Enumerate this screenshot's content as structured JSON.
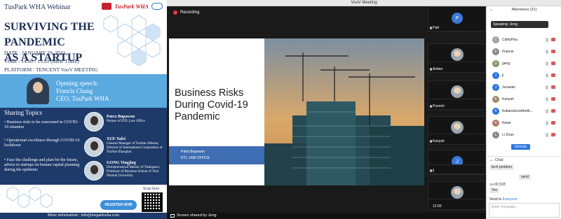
{
  "window": {
    "title": "VooV Meeting"
  },
  "poster": {
    "top_title": "TusPark WHA Webinar",
    "logo_text": "TusPark WHA",
    "headline_1": "SURVIVING THE PANDEMIC",
    "headline_2": "AS A STARTUP",
    "date": "DATE : JANUARY 29, 2021",
    "time": "TIME : 14.00 - 15.20 (BKK TIME)",
    "platform": "PLATFORM : TENCENT VooV MEETING",
    "opening_label": "Opening speech:",
    "opening_name": "Francis Chang",
    "opening_role": "CEO, TusPark WHA",
    "topics_title": "Sharing Topics",
    "topics": [
      "• Business risks to be concerned in COVID-19 situation",
      "• Operational excellence through COVID-19 lockdown",
      "• Face the challenge and plan for the future, advice to startups on human capital planning during the epidemic"
    ],
    "speakers": [
      {
        "name": "Patra Bupawon",
        "role": "Partner of DTL Law Office"
      },
      {
        "name": "XUE Yafei",
        "role": "General Manager of TusStar Alberta; Director of International Corporation of TusStar Shanghai"
      },
      {
        "name": "GONG Yingjing",
        "role": "Entrepreneurial Mentor of Tuskspace; Professor of Business School of Yuxi Normal University"
      }
    ],
    "scan_here": "Scan here",
    "register_label": "REGISTER NOW",
    "more_info": "More information : info@tusparkwha.com"
  },
  "meeting": {
    "recording_label": "Recording",
    "slide": {
      "title": "Business Risks During Covid-19 Pandemic",
      "presenter_name": "Patra Bupawon",
      "presenter_org": "DTL LAW OFFICE"
    },
    "share_label": "Screen shared by Jeng",
    "tiles": [
      {
        "name": "Patt",
        "kind": "avatar",
        "initial": "P"
      },
      {
        "name": "",
        "kind": "photo",
        "initial": ""
      },
      {
        "name": "Amber",
        "kind": "none",
        "initial": ""
      },
      {
        "name": "",
        "kind": "photo",
        "initial": ""
      },
      {
        "name": "Poorich",
        "kind": "none",
        "initial": ""
      },
      {
        "name": "",
        "kind": "photo",
        "initial": ""
      },
      {
        "name": "Kanyah",
        "kind": "none",
        "initial": ""
      },
      {
        "name": "",
        "kind": "avatar",
        "initial": "J"
      },
      {
        "name": "ji",
        "kind": "none",
        "initial": ""
      },
      {
        "name": "",
        "kind": "photo",
        "initial": ""
      },
      {
        "name": "12:00",
        "kind": "none",
        "initial": ""
      }
    ]
  },
  "attendees": {
    "header": "Attendees (31)",
    "speaking": "Speaking: Jeng;",
    "list": [
      {
        "name": "CathyHou",
        "initial": "C",
        "color": "#9e9e9e"
      },
      {
        "name": "Francis",
        "initial": "F",
        "color": "#8a8a8a"
      },
      {
        "name": "geng",
        "initial": "G",
        "color": "#7a9a6a"
      },
      {
        "name": "ji",
        "initial": "J",
        "color": "#2b77e0"
      },
      {
        "name": "Jurawan",
        "initial": "J",
        "color": "#2b77e0"
      },
      {
        "name": "Kanyah",
        "initial": "K",
        "color": "#a0896a"
      },
      {
        "name": "KultaraSoonkhetb...",
        "initial": "K",
        "color": "#2b77e0"
      },
      {
        "name": "Kwan",
        "initial": "K",
        "color": "#b07a6a"
      },
      {
        "name": "Li Ziran",
        "initial": "L",
        "color": "#8a8a8a"
      }
    ],
    "unmute_label": "Unmute"
  },
  "chat": {
    "header": "Chat",
    "messages": [
      {
        "sender": "",
        "text": "tech problem"
      },
      {
        "sender": "",
        "text": "send"
      },
      {
        "sender": "ace新加坡",
        "text": "Yes"
      }
    ],
    "send_to_label": "Send to",
    "send_to_value": "Everyone",
    "input_placeholder": "Enter message..."
  }
}
